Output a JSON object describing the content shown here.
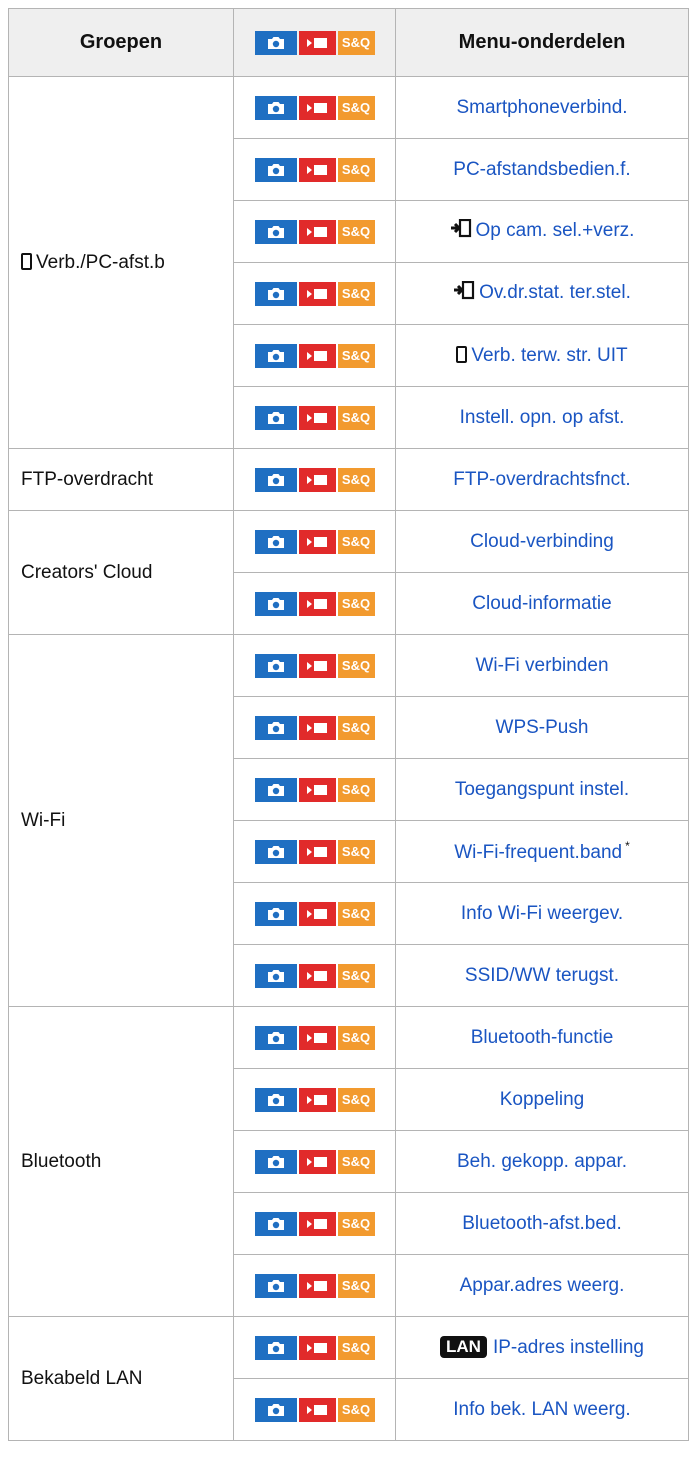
{
  "header": {
    "col_groups": "Groepen",
    "col_items": "Menu-onderdelen"
  },
  "mode_badges": {
    "photo": "photo-mode-icon",
    "movie": "movie-mode-icon",
    "sq_label": "S&Q"
  },
  "colors": {
    "photo": "#1f6fc2",
    "movie": "#e12a2a",
    "sq": "#f29a2e",
    "link": "#1a55c2"
  },
  "groups": [
    {
      "name": "Verb./PC-afst.b",
      "icon": "smartphone-icon",
      "items": [
        {
          "label": "Smartphoneverbind."
        },
        {
          "label": "PC-afstandsbedien.f."
        },
        {
          "label": "Op cam. sel.+verz.",
          "icon": "transfer-icon"
        },
        {
          "label": "Ov.dr.stat. ter.stel.",
          "icon": "transfer-icon"
        },
        {
          "label": "Verb. terw. str. UIT",
          "icon": "smartphone-icon"
        },
        {
          "label": "Instell. opn. op afst."
        }
      ]
    },
    {
      "name": "FTP-overdracht",
      "items": [
        {
          "label": "FTP-overdrachtsfnct."
        }
      ]
    },
    {
      "name": "Creators' Cloud",
      "items": [
        {
          "label": "Cloud-verbinding"
        },
        {
          "label": "Cloud-informatie"
        }
      ]
    },
    {
      "name": "Wi-Fi",
      "items": [
        {
          "label": "Wi-Fi verbinden"
        },
        {
          "label": "WPS-Push"
        },
        {
          "label": "Toegangspunt instel."
        },
        {
          "label": "Wi-Fi-frequent.band",
          "note": "*"
        },
        {
          "label": "Info Wi-Fi weergev."
        },
        {
          "label": "SSID/WW terugst."
        }
      ]
    },
    {
      "name": "Bluetooth",
      "items": [
        {
          "label": "Bluetooth-functie"
        },
        {
          "label": "Koppeling"
        },
        {
          "label": "Beh. gekopp. appar."
        },
        {
          "label": "Bluetooth-afst.bed."
        },
        {
          "label": "Appar.adres weerg."
        }
      ]
    },
    {
      "name": "Bekabeld LAN",
      "items": [
        {
          "label": "IP-adres instelling",
          "icon": "lan-icon",
          "icon_text": "LAN"
        },
        {
          "label": "Info bek. LAN weerg."
        }
      ]
    }
  ]
}
